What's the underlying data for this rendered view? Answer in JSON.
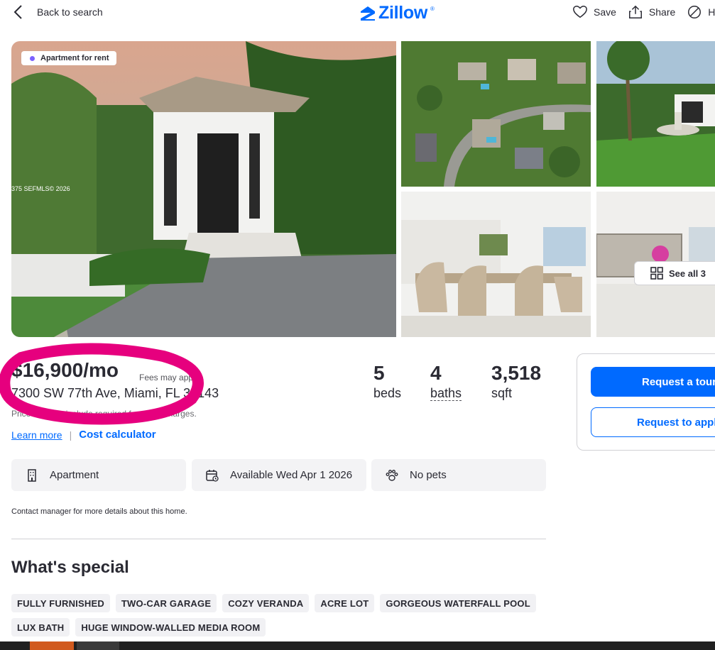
{
  "header": {
    "back_label": "Back to search",
    "logo_text": "Zillow",
    "logo_mark": "®",
    "actions": [
      {
        "label": "Save",
        "icon": "heart-icon"
      },
      {
        "label": "Share",
        "icon": "share-icon"
      },
      {
        "label": "Hi",
        "icon": "hide-icon"
      }
    ]
  },
  "gallery": {
    "badge": "Apartment for rent",
    "watermark": "375 SEFMLS© 2026",
    "see_all_label": "See all 3"
  },
  "listing": {
    "price": "$16,900/mo",
    "fees_note": "Fees may apply",
    "address": "7300 SW 77th Ave, Miami, FL 33143",
    "disclaimer": "Price may not include required fees and charges.",
    "learn_more": "Learn more",
    "separator": "|",
    "cost_calculator": "Cost calculator",
    "stats": [
      {
        "num": "5",
        "label": "beds"
      },
      {
        "num": "4",
        "label": "baths"
      },
      {
        "num": "3,518",
        "label": "sqft"
      }
    ]
  },
  "cta": {
    "request_tour": "Request a tour",
    "request_apply": "Request to apply"
  },
  "facts": [
    {
      "icon": "building-icon",
      "label": "Apartment"
    },
    {
      "icon": "calendar-icon",
      "label": "Available Wed Apr 1 2026"
    },
    {
      "icon": "paw-icon",
      "label": "No pets"
    }
  ],
  "contact_note": "Contact manager for more details about this home.",
  "whats_special": {
    "title": "What's special",
    "chips": [
      "FULLY FURNISHED",
      "TWO-CAR GARAGE",
      "COZY VERANDA",
      "ACRE LOT",
      "GORGEOUS WATERFALL POOL",
      "LUX BATH",
      "HUGE WINDOW-WALLED MEDIA ROOM"
    ]
  },
  "colors": {
    "accent": "#006aff",
    "marker": "#e6007e",
    "text": "#2a2a33"
  }
}
